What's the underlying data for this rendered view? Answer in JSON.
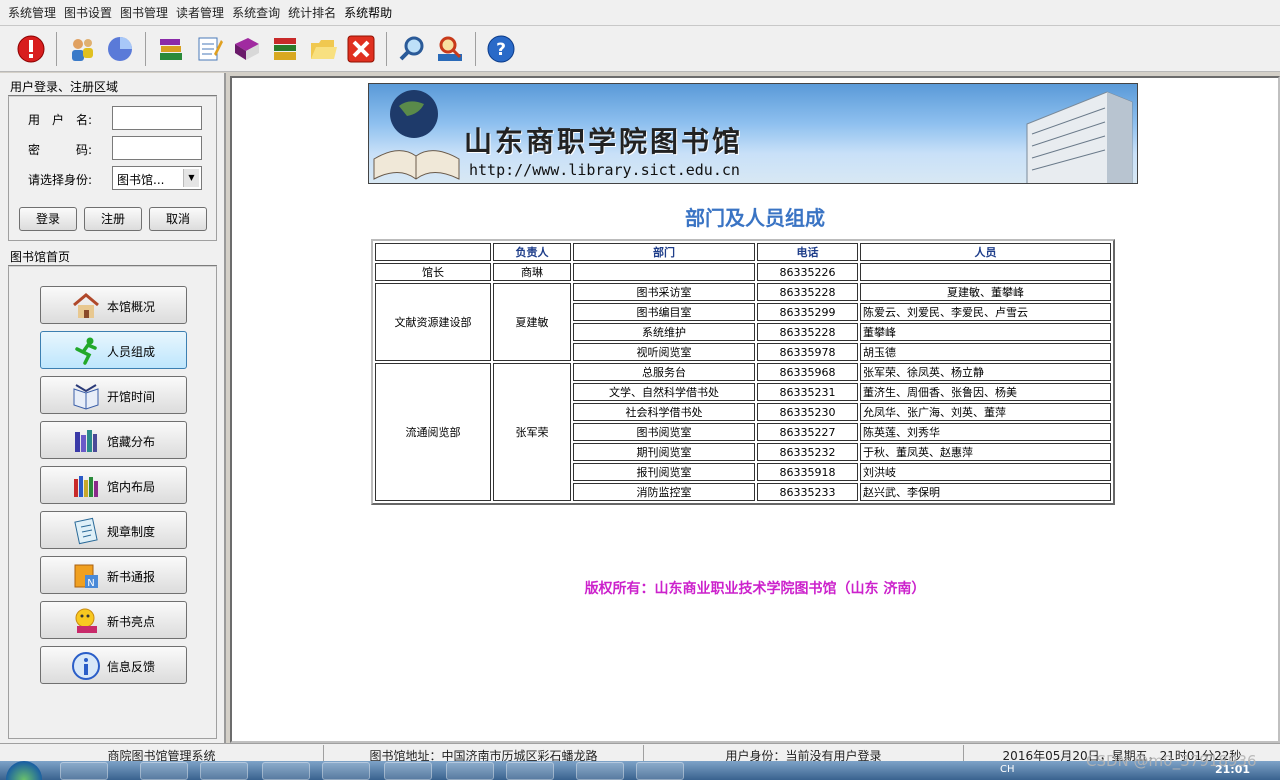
{
  "menu": [
    "系统管理",
    "图书设置",
    "图书管理",
    "读者管理",
    "系统查询",
    "统计排名",
    "系统帮助"
  ],
  "toolbar": {
    "icons": [
      "exclamation-icon",
      "users-icon",
      "pie-icon",
      "books-icon",
      "notepad-icon",
      "book-icon",
      "stack-icon",
      "folder-icon",
      "close-icon",
      "search-icon",
      "find-icon",
      "help-icon"
    ]
  },
  "login": {
    "group_title": "用户登录、注册区域",
    "username_label": "用　户　名:",
    "password_label": "密　　　码:",
    "role_label": "请选择身份:",
    "role_value": "图书馆...",
    "login_label": "登录",
    "register_label": "注册",
    "cancel_label": "取消"
  },
  "nav": {
    "group_title": "图书馆首页",
    "items": [
      {
        "label": "本馆概况",
        "color": "#b06a2a"
      },
      {
        "label": "人员组成",
        "color": "#22a82a"
      },
      {
        "label": "开馆时间",
        "color": "#3a5ea8"
      },
      {
        "label": "馆藏分布",
        "color": "#5a4aa8"
      },
      {
        "label": "馆内布局",
        "color": "#a83a3a"
      },
      {
        "label": "规章制度",
        "color": "#4a8ac8"
      },
      {
        "label": "新书通报",
        "color": "#e09a22"
      },
      {
        "label": "新书亮点",
        "color": "#e0b022"
      },
      {
        "label": "信息反馈",
        "color": "#2a5ec8"
      }
    ]
  },
  "banner": {
    "title": "山东商职学院图书馆",
    "url": "http://www.library.sict.edu.cn"
  },
  "main": {
    "heading": "部门及人员组成",
    "copyright": "版权所有：山东商业职业技术学院图书馆（山东 济南）"
  },
  "table": {
    "headers": [
      "",
      "负责人",
      "部门",
      "电话",
      "人员"
    ],
    "head_row": {
      "unit": "馆长",
      "leader": "商琳",
      "dept": "",
      "phone": "86335226",
      "people": ""
    },
    "groups": [
      {
        "unit": "文献资源建设部",
        "leader": "夏建敏",
        "rows": [
          {
            "dept": "图书采访室",
            "phone": "86335228",
            "people": "夏建敏、董攀峰"
          },
          {
            "dept": "图书编目室",
            "phone": "86335299",
            "people": "陈爱云、刘爱民、李爱民、卢雪云"
          },
          {
            "dept": "系统维护",
            "phone": "86335228",
            "people": "董攀峰"
          },
          {
            "dept": "视听阅览室",
            "phone": "86335978",
            "people": "胡玉德"
          }
        ]
      },
      {
        "unit": "流通阅览部",
        "leader": "张军荣",
        "rows": [
          {
            "dept": "总服务台",
            "phone": "86335968",
            "people": "张军荣、徐凤英、杨立静"
          },
          {
            "dept": "文学、自然科学借书处",
            "phone": "86335231",
            "people": "董济生、周佃香、张鲁因、杨美"
          },
          {
            "dept": "社会科学借书处",
            "phone": "86335230",
            "people": "允凤华、张广海、刘英、董萍"
          },
          {
            "dept": "图书阅览室",
            "phone": "86335227",
            "people": "陈英莲、刘秀华"
          },
          {
            "dept": "期刊阅览室",
            "phone": "86335232",
            "people": "于秋、董凤英、赵惠萍"
          },
          {
            "dept": "报刊阅览室",
            "phone": "86335918",
            "people": "刘洪岐"
          },
          {
            "dept": "消防监控室",
            "phone": "86335233",
            "people": "赵兴武、李保明"
          }
        ]
      }
    ]
  },
  "status": {
    "system_name": "商院图书馆管理系统",
    "address": "图书馆地址：中国济南市历城区彩石蟠龙路",
    "user_status": "用户身份：当前没有用户登录",
    "datetime": "2016年05月20日，星期五，21时01分22秒"
  },
  "taskbar": {
    "clock": "21:01",
    "tray": "CH",
    "watermark": "CSDN @m0_37918936"
  }
}
